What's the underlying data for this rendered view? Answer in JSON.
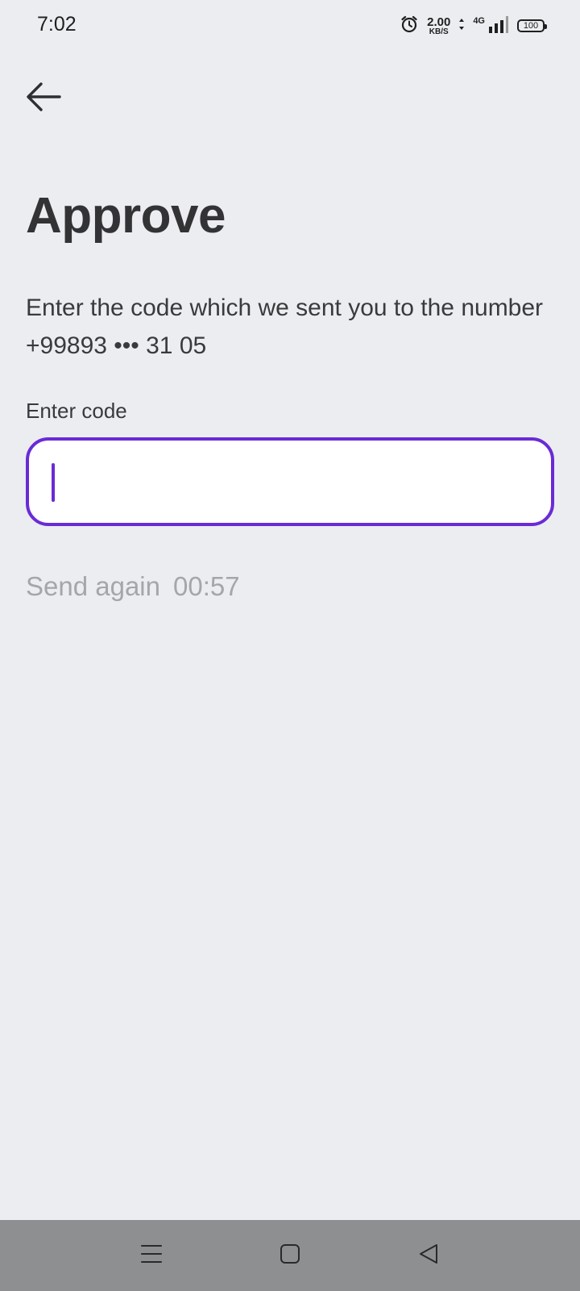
{
  "status_bar": {
    "time": "7:02",
    "net_speed_value": "2.00",
    "net_speed_unit": "KB/S",
    "network_type": "4G",
    "battery": "100",
    "icons": [
      "alarm-icon",
      "data-arrows-icon",
      "signal-icon",
      "battery-icon"
    ]
  },
  "header": {
    "back_icon": "arrow-left-icon",
    "title": "Approve"
  },
  "body": {
    "description_line1": "Enter the code which we sent you to the number",
    "description_line2": "+99893 ••• 31 05",
    "field_label": "Enter code",
    "code_value": "",
    "code_placeholder": "",
    "send_again_label": "Send again",
    "send_again_timer": "00:57"
  },
  "nav_bar": {
    "icons": [
      "menu-icon",
      "home-square-icon",
      "back-triangle-icon"
    ]
  },
  "colors": {
    "background": "#ecedf0",
    "accent": "#6a2bd6",
    "text": "#3a3a3c",
    "muted": "#a5a6aa",
    "nav_bar": "#8e8f91"
  }
}
